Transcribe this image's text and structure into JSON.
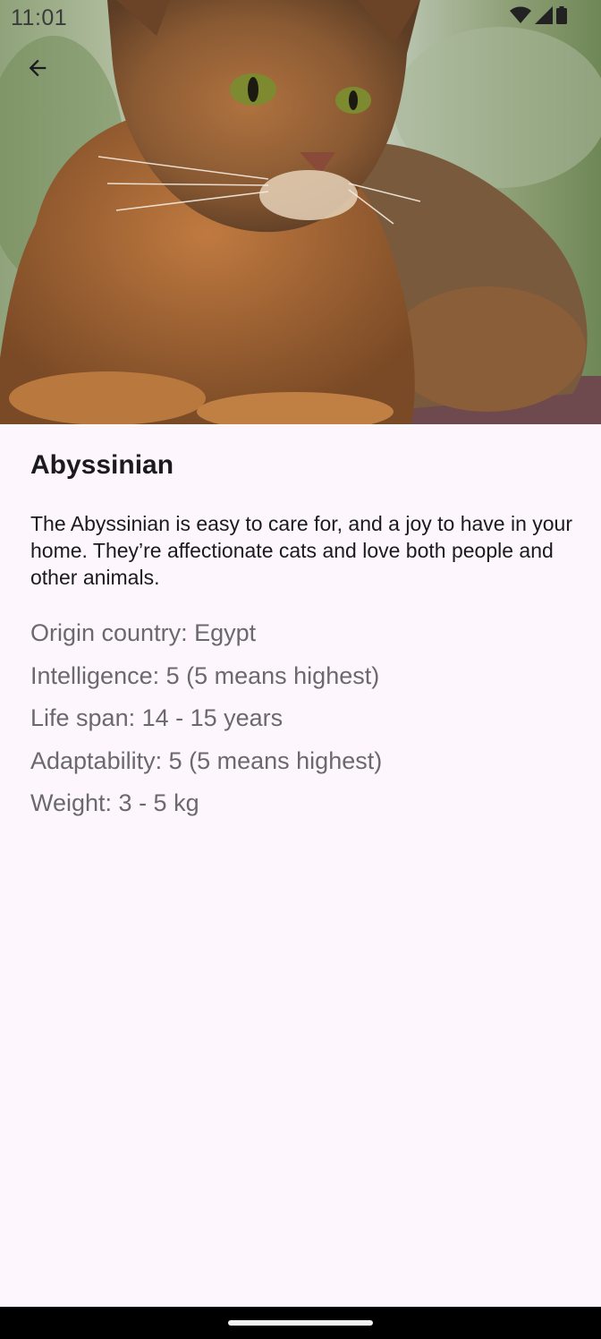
{
  "status_bar": {
    "time": "11:01",
    "icons": [
      "wifi-icon",
      "signal-icon",
      "battery-icon"
    ]
  },
  "toolbar": {
    "back_icon": "arrow-back-icon"
  },
  "hero": {
    "description": "cat photo"
  },
  "breed": {
    "name": "Abyssinian",
    "description": "The Abyssinian is easy to care for, and a joy to have in your home. They’re affectionate cats and love both people and other animals.",
    "origin": "Origin country: Egypt",
    "intelligence": "Intelligence: 5 (5 means highest)",
    "life_span": "Life span: 14 - 15 years",
    "adaptability": "Adaptability: 5 (5 means highest)",
    "weight": "Weight: 3 - 5 kg"
  },
  "colors": {
    "background": "#fdf7fd",
    "title": "#1b1b1f",
    "attribute_text": "#6b6870"
  }
}
